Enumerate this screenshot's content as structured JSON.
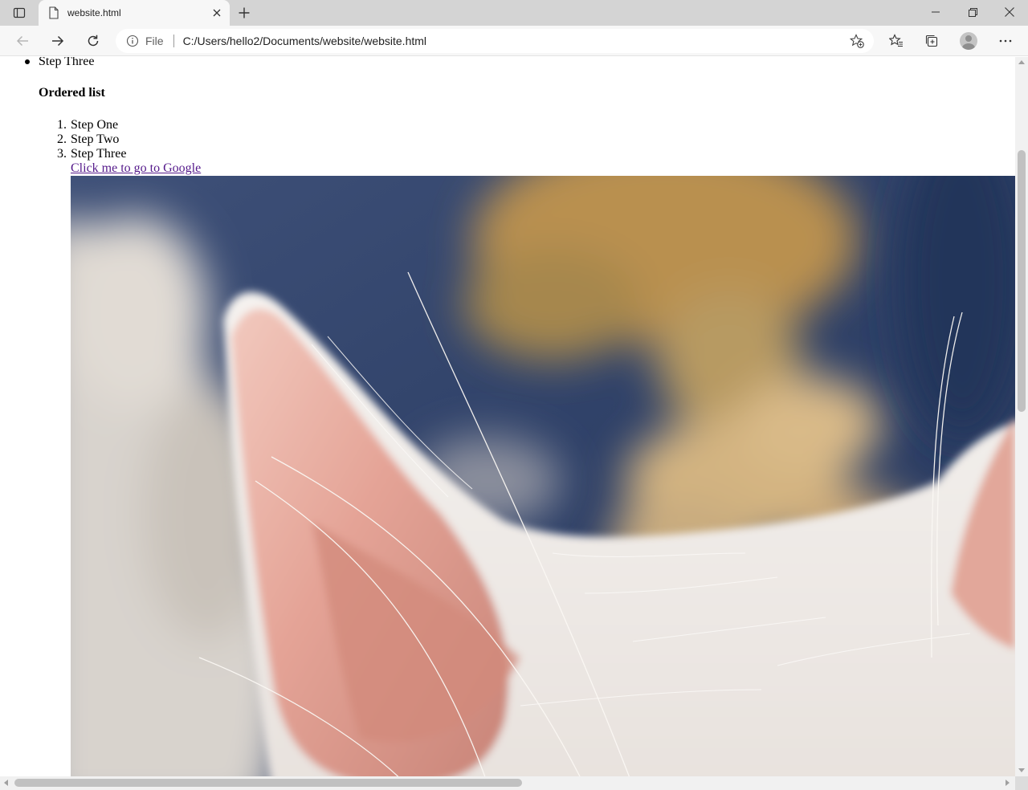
{
  "browser": {
    "tab_title": "website.html",
    "address_scheme": "File",
    "address_url": "C:/Users/hello2/Documents/website/website.html"
  },
  "page": {
    "unordered_list": {
      "items": [
        "Step Three"
      ]
    },
    "ordered_list": {
      "heading": "Ordered list",
      "items": [
        {
          "number": "1.",
          "label": "Step One"
        },
        {
          "number": "2.",
          "label": "Step Two"
        },
        {
          "number": "3.",
          "label": "Step Three"
        }
      ]
    },
    "link_text": "Click me to go to Google"
  },
  "colors": {
    "tab_bar": "#d4d4d4",
    "toolbar": "#f7f7f7",
    "visited_link": "#551a8b"
  }
}
